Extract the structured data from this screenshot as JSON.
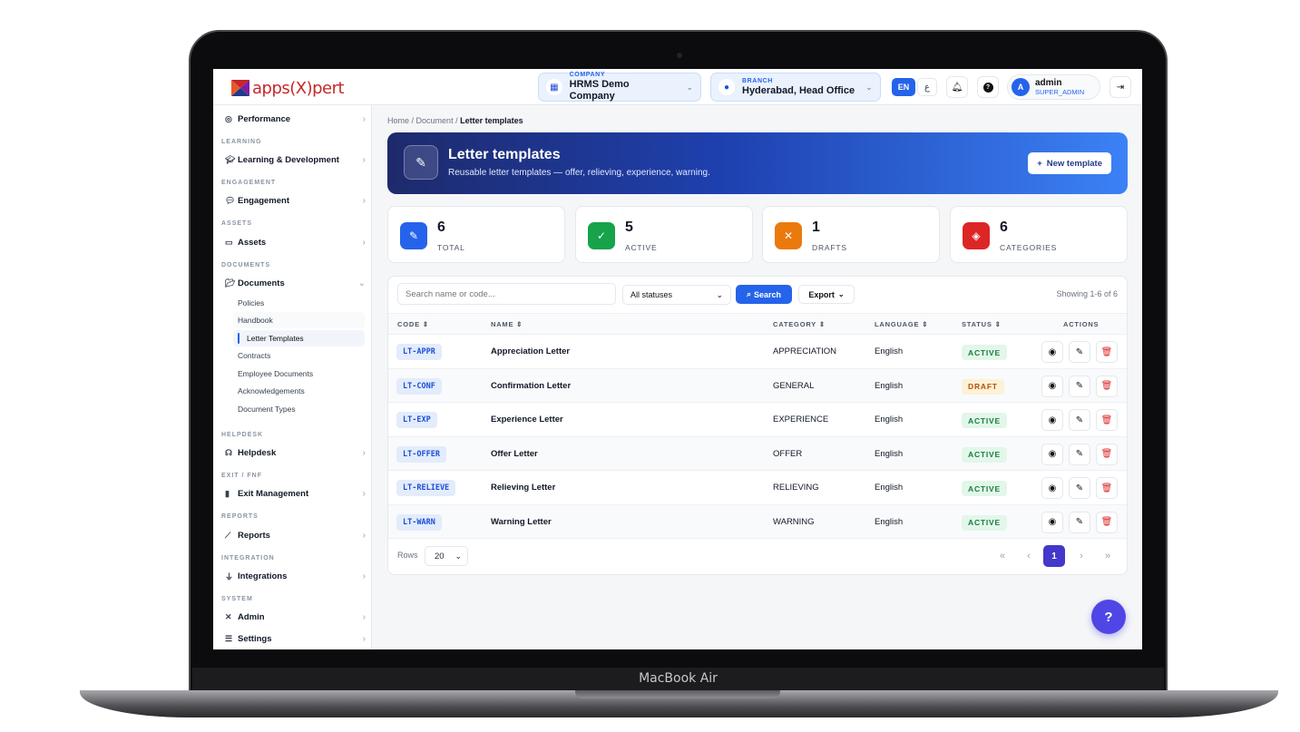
{
  "device": {
    "label": "MacBook Air"
  },
  "brand": {
    "logo_text": "apps(X)pert",
    "accent": "#c62828"
  },
  "topbar": {
    "company": {
      "caption": "COMPANY",
      "value": "HRMS Demo Company"
    },
    "branch": {
      "caption": "BRANCH",
      "value": "Hyderabad, Head Office"
    },
    "lang_active": "EN",
    "lang_alt": "ع",
    "user": {
      "initial": "A",
      "name": "admin",
      "role": "SUPER_ADMIN"
    },
    "icons": [
      "bell-icon",
      "help-icon",
      "logout-icon"
    ]
  },
  "sidebar": {
    "top_item": "Performance",
    "sections": [
      {
        "title": "LEARNING",
        "item": "Learning & Development"
      },
      {
        "title": "ENGAGEMENT",
        "item": "Engagement"
      },
      {
        "title": "ASSETS",
        "item": "Assets"
      },
      {
        "title": "DOCUMENTS",
        "item": "Documents"
      },
      {
        "title": "HELPDESK",
        "item": "Helpdesk"
      },
      {
        "title": "EXIT / FNF",
        "item": "Exit Management"
      },
      {
        "title": "REPORTS",
        "item": "Reports"
      },
      {
        "title": "INTEGRATION",
        "item": "Integrations"
      },
      {
        "title": "SYSTEM",
        "item": "Admin"
      }
    ],
    "documents_sub": [
      "Policies",
      "Handbook",
      "Letter Templates",
      "Contracts",
      "Employee Documents",
      "Acknowledgements",
      "Document Types"
    ],
    "settings": "Settings"
  },
  "breadcrumb": {
    "home": "Home",
    "section": "Document",
    "current": "Letter templates"
  },
  "hero": {
    "title": "Letter templates",
    "subtitle": "Reusable letter templates — offer, relieving, experience, warning.",
    "new_button": "New template"
  },
  "stats": [
    {
      "value": "6",
      "label": "TOTAL",
      "color": "#2563eb"
    },
    {
      "value": "5",
      "label": "ACTIVE",
      "color": "#16a34a"
    },
    {
      "value": "1",
      "label": "DRAFTS",
      "color": "#ea7a0c"
    },
    {
      "value": "6",
      "label": "CATEGORIES",
      "color": "#dc2626"
    }
  ],
  "toolbar": {
    "search_placeholder": "Search name or code...",
    "status_filter": "All statuses",
    "search_button": "Search",
    "export_button": "Export",
    "showing": "Showing 1-6 of 6"
  },
  "table": {
    "headers": [
      "CODE",
      "NAME",
      "CATEGORY",
      "LANGUAGE",
      "STATUS",
      "ACTIONS"
    ],
    "rows": [
      {
        "code": "LT-APPR",
        "name": "Appreciation Letter",
        "category": "APPRECIATION",
        "language": "English",
        "status": "ACTIVE"
      },
      {
        "code": "LT-CONF",
        "name": "Confirmation Letter",
        "category": "GENERAL",
        "language": "English",
        "status": "DRAFT"
      },
      {
        "code": "LT-EXP",
        "name": "Experience Letter",
        "category": "EXPERIENCE",
        "language": "English",
        "status": "ACTIVE"
      },
      {
        "code": "LT-OFFER",
        "name": "Offer Letter",
        "category": "OFFER",
        "language": "English",
        "status": "ACTIVE"
      },
      {
        "code": "LT-RELIEVE",
        "name": "Relieving Letter",
        "category": "RELIEVING",
        "language": "English",
        "status": "ACTIVE"
      },
      {
        "code": "LT-WARN",
        "name": "Warning Letter",
        "category": "WARNING",
        "language": "English",
        "status": "ACTIVE"
      }
    ]
  },
  "pagination": {
    "rows_label": "Rows",
    "rows_value": "20",
    "current_page": "1"
  },
  "help_fab": "?"
}
